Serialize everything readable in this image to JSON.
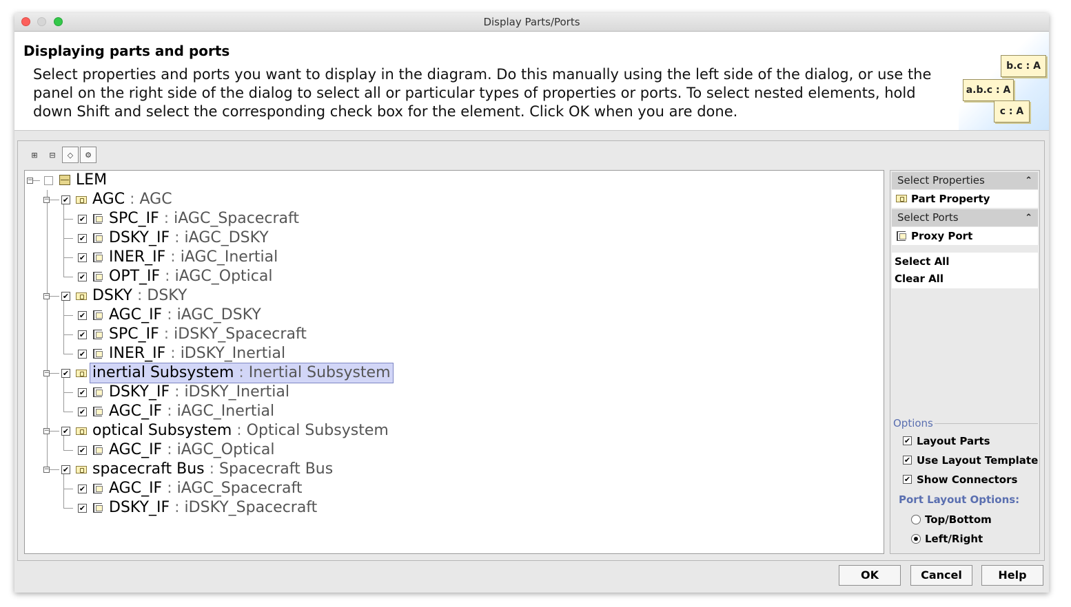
{
  "window": {
    "title": "Display Parts/Ports"
  },
  "header": {
    "title": "Displaying parts and ports",
    "description": "Select properties and ports you want to display in the diagram. Do this manually using the left side of the dialog, or use the panel on the right side of the dialog to select all or particular types of properties or ports. To select nested elements, hold down Shift and select the corresponding check box for the element. Click OK when you are done.",
    "illustration_labels": [
      "b.c : A",
      "a.b.c : A",
      "c : A"
    ]
  },
  "toolbar": {
    "buttons": [
      {
        "icon": "expand-all-icon",
        "pressed": false
      },
      {
        "icon": "collapse-all-icon",
        "pressed": false
      },
      {
        "icon": "show-ports-icon",
        "pressed": true
      },
      {
        "icon": "show-properties-icon",
        "pressed": true
      }
    ]
  },
  "tree": {
    "rows": [
      {
        "level": 0,
        "kind": "root",
        "checked": false,
        "name": "LEM",
        "type": "",
        "expander": "minus"
      },
      {
        "level": 1,
        "kind": "part",
        "checked": true,
        "name": "AGC",
        "type": "AGC",
        "expander": "minus"
      },
      {
        "level": 2,
        "kind": "port",
        "checked": true,
        "name": "SPC_IF",
        "type": "iAGC_Spacecraft"
      },
      {
        "level": 2,
        "kind": "port",
        "checked": true,
        "name": "DSKY_IF",
        "type": "iAGC_DSKY"
      },
      {
        "level": 2,
        "kind": "port",
        "checked": true,
        "name": "INER_IF",
        "type": "iAGC_Inertial"
      },
      {
        "level": 2,
        "kind": "port",
        "checked": true,
        "name": "OPT_IF",
        "type": "iAGC_Optical",
        "last": true
      },
      {
        "level": 1,
        "kind": "part",
        "checked": true,
        "name": "DSKY",
        "type": "DSKY",
        "expander": "minus"
      },
      {
        "level": 2,
        "kind": "port",
        "checked": true,
        "name": "AGC_IF",
        "type": "iAGC_DSKY"
      },
      {
        "level": 2,
        "kind": "port",
        "checked": true,
        "name": "SPC_IF",
        "type": "iDSKY_Spacecraft"
      },
      {
        "level": 2,
        "kind": "port",
        "checked": true,
        "name": "INER_IF",
        "type": "iDSKY_Inertial",
        "last": true
      },
      {
        "level": 1,
        "kind": "part",
        "checked": true,
        "name": "inertial Subsystem",
        "type": "Inertial Subsystem",
        "expander": "minus",
        "selected": true
      },
      {
        "level": 2,
        "kind": "port",
        "checked": true,
        "name": "DSKY_IF",
        "type": "iDSKY_Inertial"
      },
      {
        "level": 2,
        "kind": "port",
        "checked": true,
        "name": "AGC_IF",
        "type": "iAGC_Inertial",
        "last": true
      },
      {
        "level": 1,
        "kind": "part",
        "checked": true,
        "name": "optical Subsystem",
        "type": "Optical Subsystem",
        "expander": "minus"
      },
      {
        "level": 2,
        "kind": "port",
        "checked": true,
        "name": "AGC_IF",
        "type": "iAGC_Optical",
        "last": true
      },
      {
        "level": 1,
        "kind": "part",
        "checked": true,
        "name": "spacecraft Bus",
        "type": "Spacecraft Bus",
        "expander": "minus"
      },
      {
        "level": 2,
        "kind": "port",
        "checked": true,
        "name": "AGC_IF",
        "type": "iAGC_Spacecraft"
      },
      {
        "level": 2,
        "kind": "port",
        "checked": true,
        "name": "DSKY_IF",
        "type": "iDSKY_Spacecraft",
        "last": true
      }
    ],
    "separator": ":"
  },
  "right_panel": {
    "select_properties": {
      "header": "Select Properties",
      "items": [
        "Part Property"
      ]
    },
    "select_ports": {
      "header": "Select Ports",
      "items": [
        "Proxy Port"
      ]
    },
    "select_all": "Select All",
    "clear_all": "Clear All",
    "options": {
      "legend": "Options",
      "checkboxes": [
        {
          "label": "Layout Parts",
          "checked": true
        },
        {
          "label": "Use Layout Template",
          "checked": true
        },
        {
          "label": "Show Connectors",
          "checked": true
        }
      ],
      "port_layout_title": "Port Layout Options:",
      "radios": [
        {
          "label": "Top/Bottom",
          "selected": false
        },
        {
          "label": "Left/Right",
          "selected": true
        }
      ]
    }
  },
  "buttons": {
    "ok": "OK",
    "cancel": "Cancel",
    "help": "Help"
  },
  "colors": {
    "selection_bg": "#d2d6f7",
    "options_accent": "#5a6fb0",
    "close": "#fc605c",
    "minimize": "#d6d6d6",
    "zoom": "#34c84a"
  }
}
